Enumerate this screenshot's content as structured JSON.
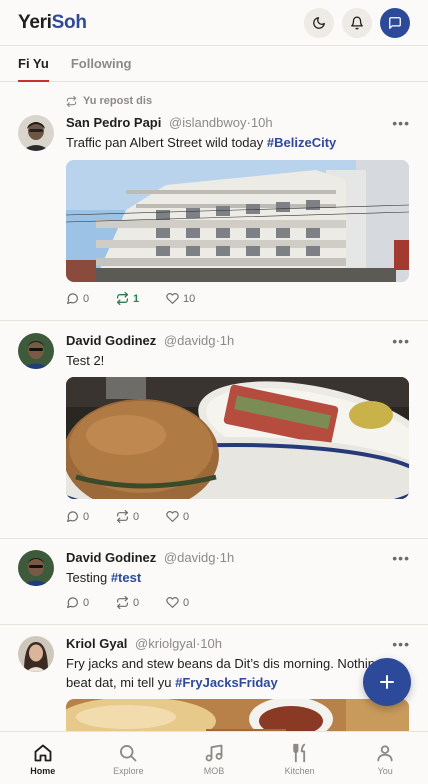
{
  "header": {
    "logo_part1": "Yeri",
    "logo_part2": "Soh"
  },
  "tabs": [
    {
      "label": "Fi Yu",
      "active": true
    },
    {
      "label": "Following",
      "active": false
    }
  ],
  "posts": [
    {
      "repost_label": "Yu repost dis",
      "name": "San Pedro Papi",
      "handle": "@islandbwoy",
      "time": "10h",
      "text_plain": "Traffic pan Albert Street wild today ",
      "hashtag": "#BelizeCity",
      "has_image": true,
      "replies": "0",
      "reposts": "1",
      "likes": "10"
    },
    {
      "name": "David Godinez",
      "handle": "@davidg",
      "time": "1h",
      "text_plain": "Test 2!",
      "has_image": true,
      "replies": "0",
      "reposts": "0",
      "likes": "0"
    },
    {
      "name": "David Godinez",
      "handle": "@davidg",
      "time": "1h",
      "text_plain": "Testing ",
      "hashtag": "#test",
      "replies": "0",
      "reposts": "0",
      "likes": "0"
    },
    {
      "name": "Kriol Gyal",
      "handle": "@kriolgyal",
      "time": "10h",
      "text_plain": "Fry jacks and stew beans da Dit’s dis morning. Nothing beat dat, mi tell yu ",
      "hashtag": "#FryJacksFriday",
      "has_image": true
    }
  ],
  "separator": "·",
  "nav": [
    {
      "label": "Home",
      "icon": "home-icon",
      "active": true
    },
    {
      "label": "Explore",
      "icon": "search-icon",
      "active": false
    },
    {
      "label": "MOB",
      "icon": "music-icon",
      "active": false
    },
    {
      "label": "Kitchen",
      "icon": "fork-knife-icon",
      "active": false
    },
    {
      "label": "You",
      "icon": "user-icon",
      "active": false
    }
  ],
  "colors": {
    "brand": "#2d4a9a",
    "tab_underline": "#c8312c",
    "repost_active": "#2e7d4f"
  }
}
